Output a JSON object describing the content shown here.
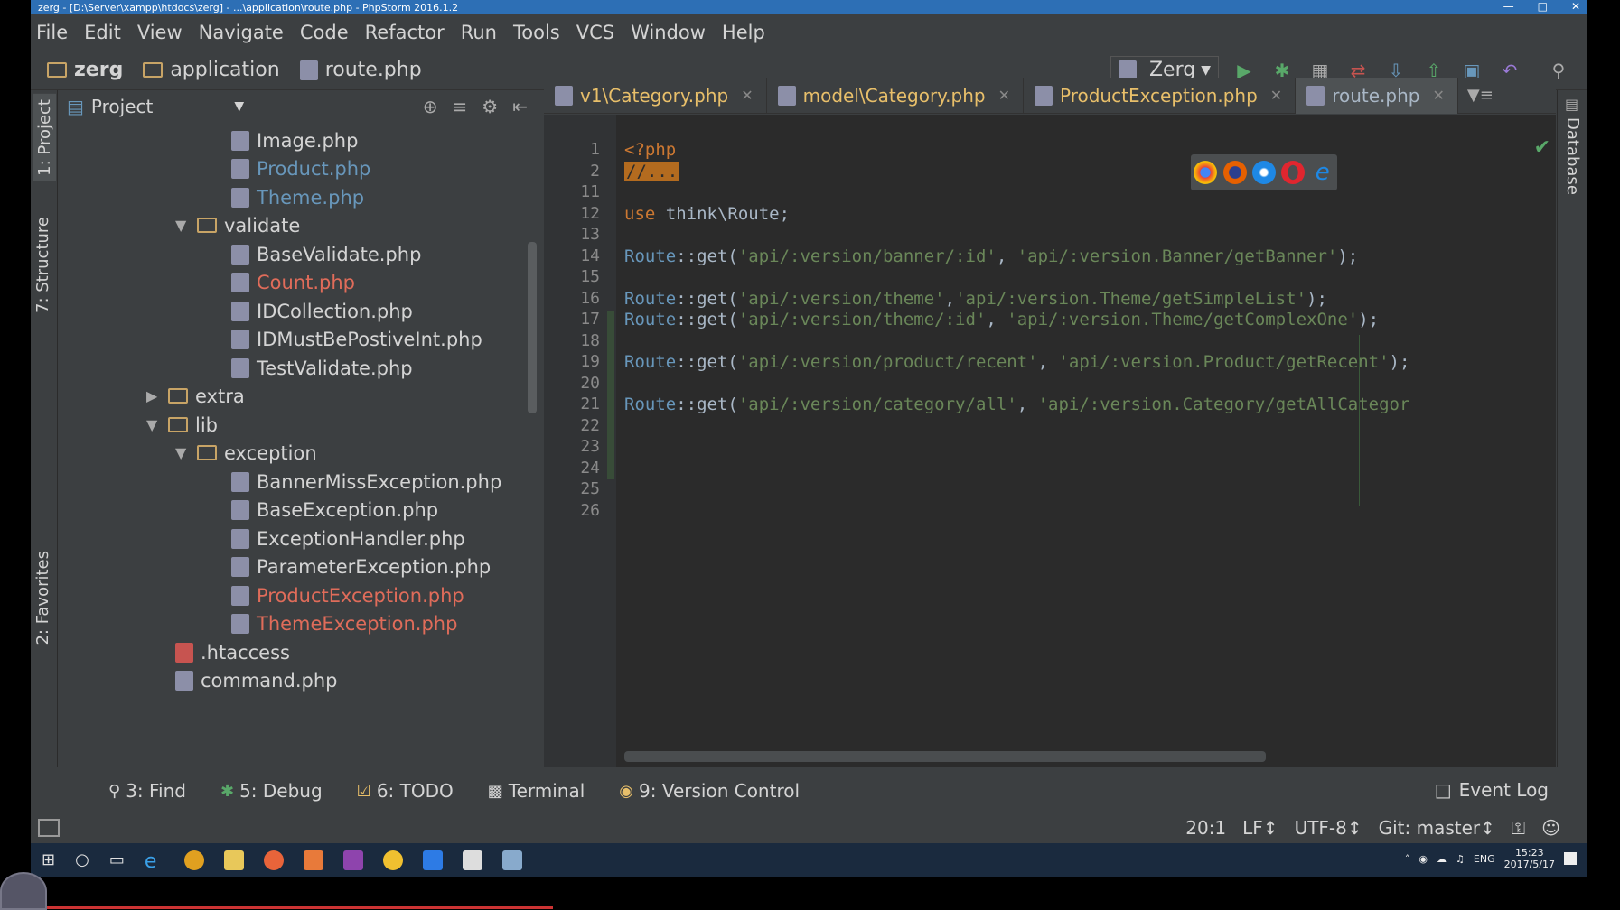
{
  "window": {
    "title": "zerg - [D:\\Server\\xampp\\htdocs\\zerg] - ...\\application\\route.php - PhpStorm 2016.1.2"
  },
  "menu": [
    "File",
    "Edit",
    "View",
    "Navigate",
    "Code",
    "Refactor",
    "Run",
    "Tools",
    "VCS",
    "Window",
    "Help"
  ],
  "breadcrumb": [
    "zerg",
    "application",
    "route.php"
  ],
  "toolbar": {
    "run_config": "Zerg"
  },
  "side_tabs": {
    "project": "1: Project",
    "structure": "7: Structure",
    "favorites": "2: Favorites",
    "database": "Database"
  },
  "project_panel": {
    "title": "Project"
  },
  "tree": [
    {
      "label": "Image.php",
      "state": "normal"
    },
    {
      "label": "Product.php",
      "state": "modified"
    },
    {
      "label": "Theme.php",
      "state": "modified"
    },
    {
      "label": "validate",
      "state": "normal"
    },
    {
      "label": "BaseValidate.php",
      "state": "normal"
    },
    {
      "label": "Count.php",
      "state": "error"
    },
    {
      "label": "IDCollection.php",
      "state": "normal"
    },
    {
      "label": "IDMustBePostiveInt.php",
      "state": "normal"
    },
    {
      "label": "TestValidate.php",
      "state": "normal"
    },
    {
      "label": "extra",
      "state": "normal"
    },
    {
      "label": "lib",
      "state": "normal"
    },
    {
      "label": "exception",
      "state": "normal"
    },
    {
      "label": "BannerMissException.php",
      "state": "normal"
    },
    {
      "label": "BaseException.php",
      "state": "normal"
    },
    {
      "label": "ExceptionHandler.php",
      "state": "normal"
    },
    {
      "label": "ParameterException.php",
      "state": "normal"
    },
    {
      "label": "ProductException.php",
      "state": "error"
    },
    {
      "label": "ThemeException.php",
      "state": "error"
    },
    {
      "label": ".htaccess",
      "state": "normal"
    },
    {
      "label": "command.php",
      "state": "normal"
    }
  ],
  "tabs": [
    {
      "label": "v1\\Category.php"
    },
    {
      "label": "model\\Category.php"
    },
    {
      "label": "ProductException.php"
    },
    {
      "label": "route.php"
    }
  ],
  "line_numbers": [
    "1",
    "2",
    "11",
    "12",
    "13",
    "14",
    "15",
    "16",
    "17",
    "18",
    "19",
    "20",
    "21",
    "22",
    "23",
    "24",
    "25",
    "26"
  ],
  "code": {
    "l1": "<?php",
    "l2": "//...",
    "l12_kw": "use",
    "l12_rest": " think\\Route;",
    "route_cls": "Route",
    "route_get": "::get(",
    "r14_a": "'api/:version/banner/:id'",
    "r14_b": "'api/:version.Banner/getBanner'",
    "r16_a": "'api/:version/theme'",
    "r16_b": "'api/:version.Theme/getSimpleList'",
    "r17_a": "'api/:version/theme/:id'",
    "r17_b": "'api/:version.Theme/getComplexOne'",
    "r19_a": "'api/:version/product/recent'",
    "r19_b": "'api/:version.Product/getRecent'",
    "r21_a": "'api/:version/category/all'",
    "r21_b": "'api/:version.Category/getAllCategor",
    "sep_space": ", ",
    "sep_nospace": ",",
    "end": ");"
  },
  "bottom_tools": [
    "3: Find",
    "5: Debug",
    "6: TODO",
    "Terminal",
    "9: Version Control"
  ],
  "event_log": "Event Log",
  "status": {
    "position": "20:1",
    "line_sep": "LF↕",
    "encoding": "UTF-8↕",
    "git": "Git: master↕"
  },
  "taskbar": {
    "lang": "ENG",
    "time": "15:23",
    "date": "2017/5/17"
  }
}
